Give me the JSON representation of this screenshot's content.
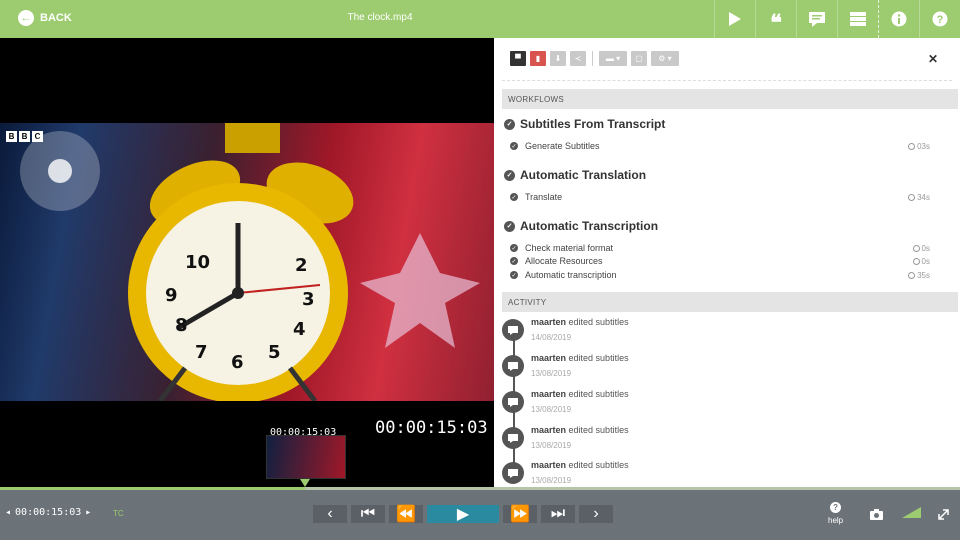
{
  "header": {
    "back_label": "BACK",
    "title": "The clock.mp4",
    "icons": [
      "play-icon",
      "quote-icon",
      "comment-icon",
      "list-icon",
      "info-icon",
      "help-icon"
    ]
  },
  "video": {
    "channel_logo": [
      "B",
      "B",
      "C"
    ],
    "thumbnail_timecode": "00:00:15:03",
    "timecode": "00:00:15:03"
  },
  "panel": {
    "workflows_header": "WORKFLOWS",
    "workflows": [
      {
        "title": "Subtitles From Transcript",
        "tasks": [
          {
            "name": "Generate Subtitles",
            "duration": "03s"
          }
        ]
      },
      {
        "title": "Automatic Translation",
        "tasks": [
          {
            "name": "Translate",
            "duration": "34s"
          }
        ]
      },
      {
        "title": "Automatic Transcription",
        "tasks": [
          {
            "name": "Check material format",
            "duration": "0s"
          },
          {
            "name": "Allocate Resources",
            "duration": "0s"
          },
          {
            "name": "Automatic transcription",
            "duration": "35s"
          }
        ]
      }
    ],
    "activity_header": "ACTIVITY",
    "activity": [
      {
        "user": "maarten",
        "action": "edited subtitles",
        "date": "14/08/2019"
      },
      {
        "user": "maarten",
        "action": "edited subtitles",
        "date": "13/08/2019"
      },
      {
        "user": "maarten",
        "action": "edited subtitles",
        "date": "13/08/2019"
      },
      {
        "user": "maarten",
        "action": "edited subtitles",
        "date": "13/08/2019"
      },
      {
        "user": "maarten",
        "action": "edited subtitles",
        "date": "13/08/2019"
      }
    ]
  },
  "player": {
    "progress_fraction": 0.318,
    "timecode": "00:00:15:03",
    "tc_label": "TC",
    "help_label": "help"
  },
  "colors": {
    "accent": "#9ccc6f",
    "control_bar": "#6b7278",
    "play_button": "#2a8aa0",
    "delete_button": "#d9534f"
  }
}
